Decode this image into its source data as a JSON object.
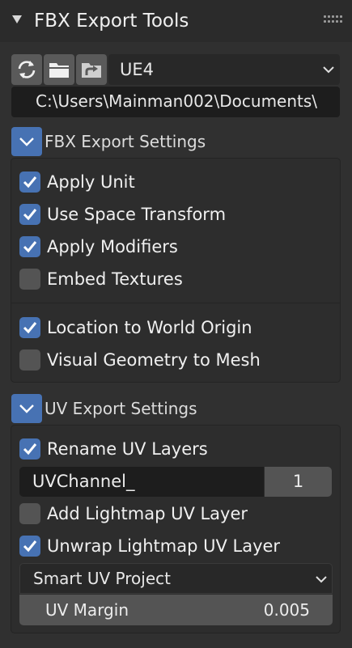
{
  "panel": {
    "title": "FBX Export Tools",
    "collapse_icon": "triangle-down-icon",
    "grip_icon": "drag-grip-icon"
  },
  "toolbar": {
    "refresh_icon": "refresh-icon",
    "folder_icon": "folder-icon",
    "export_icon": "export-icon",
    "preset_value": "UE4",
    "path_value": "C:\\Users\\Mainman002\\Documents\\"
  },
  "fbx_settings": {
    "title": "FBX Export Settings",
    "options": [
      {
        "label": "Apply Unit",
        "checked": true
      },
      {
        "label": "Use Space Transform",
        "checked": true
      },
      {
        "label": "Apply Modifiers",
        "checked": true
      },
      {
        "label": "Embed Textures",
        "checked": false
      }
    ],
    "options2": [
      {
        "label": "Location to World Origin",
        "checked": true
      },
      {
        "label": "Visual Geometry to Mesh",
        "checked": false
      }
    ]
  },
  "uv_settings": {
    "title": "UV Export Settings",
    "rename": {
      "label": "Rename UV Layers",
      "checked": true
    },
    "channel_name": "UVChannel_",
    "channel_index": "1",
    "add_lightmap": {
      "label": "Add Lightmap UV Layer",
      "checked": false
    },
    "unwrap_lightmap": {
      "label": "Unwrap Lightmap UV Layer",
      "checked": true
    },
    "unwrap_method": "Smart UV Project",
    "margin_label": "UV Margin",
    "margin_value": "0.005"
  },
  "colors": {
    "accent": "#4772b3",
    "background": "#303030"
  }
}
